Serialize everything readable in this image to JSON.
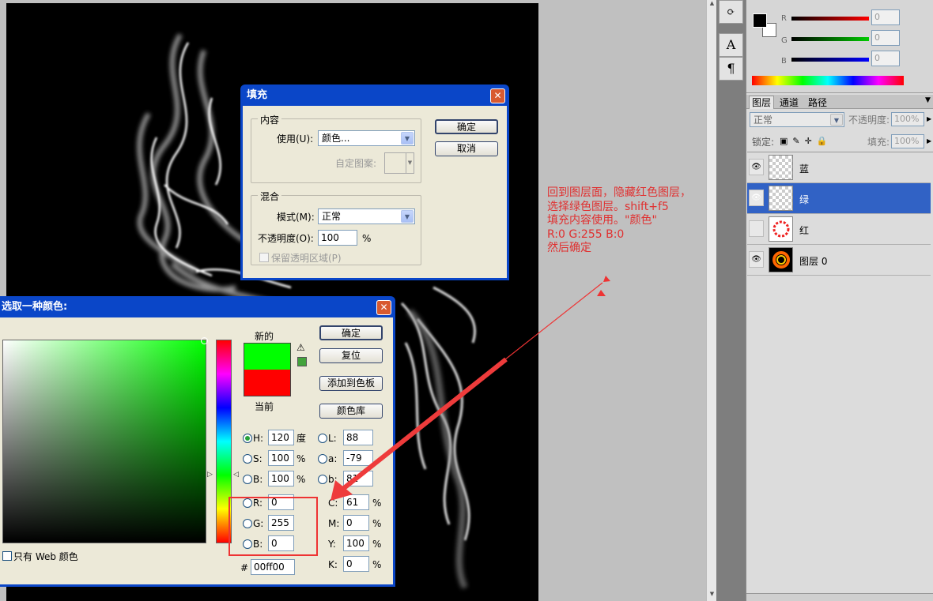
{
  "fill_dialog": {
    "title": "填充",
    "content_group": "内容",
    "use_label": "使用(U):",
    "use_value": "颜色...",
    "custom_pattern_label": "自定图案:",
    "blend_group": "混合",
    "mode_label": "模式(M):",
    "mode_value": "正常",
    "opacity_label": "不透明度(O):",
    "opacity_value": "100",
    "opacity_unit": "%",
    "preserve_label": "保留透明区域(P)",
    "ok": "确定",
    "cancel": "取消"
  },
  "picker": {
    "title": "选取一种颜色:",
    "new_label": "新的",
    "current_label": "当前",
    "ok": "确定",
    "reset": "复位",
    "add_swatch": "添加到色板",
    "libraries": "颜色库",
    "web_only": "只有 Web 颜色",
    "new_color": "#00ff00",
    "current_color": "#ff0000",
    "fields": {
      "H": {
        "label": "H:",
        "value": "120",
        "unit": "度"
      },
      "S": {
        "label": "S:",
        "value": "100",
        "unit": "%"
      },
      "Bv": {
        "label": "B:",
        "value": "100",
        "unit": "%"
      },
      "R": {
        "label": "R:",
        "value": "0"
      },
      "G": {
        "label": "G:",
        "value": "255"
      },
      "Bl": {
        "label": "B:",
        "value": "0"
      },
      "L": {
        "label": "L:",
        "value": "88"
      },
      "a": {
        "label": "a:",
        "value": "-79"
      },
      "b": {
        "label": "b:",
        "value": "81"
      },
      "C": {
        "label": "C:",
        "value": "61",
        "unit": "%"
      },
      "M": {
        "label": "M:",
        "value": "0",
        "unit": "%"
      },
      "Y": {
        "label": "Y:",
        "value": "100",
        "unit": "%"
      },
      "K": {
        "label": "K:",
        "value": "0",
        "unit": "%"
      }
    },
    "hex_label": "#",
    "hex_value": "00ff00"
  },
  "annotation": {
    "lines": [
      "回到图层面，隐藏红色图层，",
      "选择绿色图层。shift+f5",
      "填充内容使用。\"颜色\"",
      "R:0  G:255   B:0",
      "然后确定"
    ],
    "color": "#e03030"
  },
  "color_panel": {
    "r_label": "R",
    "g_label": "G",
    "b_label": "B",
    "r_value": "0",
    "g_value": "0",
    "b_value": "0"
  },
  "layers_panel": {
    "tabs": [
      "图层",
      "通道",
      "路径"
    ],
    "blend_mode": "正常",
    "opacity_label": "不透明度:",
    "opacity_value": "100%",
    "lock_label": "锁定:",
    "fill_label": "填充:",
    "fill_value": "100%",
    "layers": [
      {
        "name": "蓝",
        "visible": true,
        "selected": false
      },
      {
        "name": "绿",
        "visible": true,
        "selected": true
      },
      {
        "name": "红",
        "visible": false,
        "selected": false
      },
      {
        "name": "图层 0",
        "visible": true,
        "selected": false
      }
    ]
  },
  "dock": {
    "tool1": "A",
    "tool2": "¶"
  }
}
